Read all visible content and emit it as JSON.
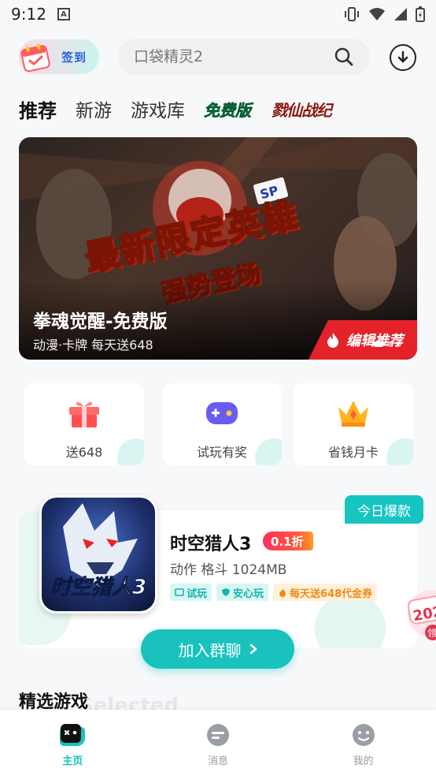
{
  "status_bar": {
    "time": "9:12"
  },
  "header": {
    "signin_label": "签到",
    "search_placeholder": "口袋精灵2"
  },
  "tabs": [
    "推荐",
    "新游",
    "游戏库",
    "免费版",
    "戮仙战纪"
  ],
  "banner": {
    "headline": "最新限定英雄",
    "subline": "强势登场",
    "title": "拳魂觉醒-免费版",
    "meta": "动漫·卡牌  每天送648",
    "badge": "编辑推荐"
  },
  "quick_actions": [
    {
      "label": "送648",
      "icon": "gift-icon",
      "color": "#ff5a5a"
    },
    {
      "label": "试玩有奖",
      "icon": "gamepad-icon",
      "color": "#6a5cf0"
    },
    {
      "label": "省钱月卡",
      "icon": "crown-icon",
      "color": "#ffb21a"
    }
  ],
  "featured": {
    "hot_tag": "今日爆款",
    "cover_title": "时空猎人3",
    "name": "时空猎人3",
    "discount": "0.1折",
    "meta": "动作 格斗 1024MB",
    "chips": [
      "试玩",
      "安心玩",
      "每天送648代金券"
    ],
    "join_label": "加入群聊",
    "float_badge_top": "202",
    "float_badge_bottom": "领"
  },
  "section": {
    "title": "精选游戏",
    "ghost": "Selected"
  },
  "bottom_nav": [
    {
      "label": "主页",
      "icon": "home-game-icon",
      "active": true
    },
    {
      "label": "消息",
      "icon": "message-icon",
      "active": false
    },
    {
      "label": "我的",
      "icon": "profile-icon",
      "active": false
    }
  ],
  "colors": {
    "accent": "#17c4c0",
    "banner_red": "#e3222a",
    "discount": "#ff2f5b"
  }
}
